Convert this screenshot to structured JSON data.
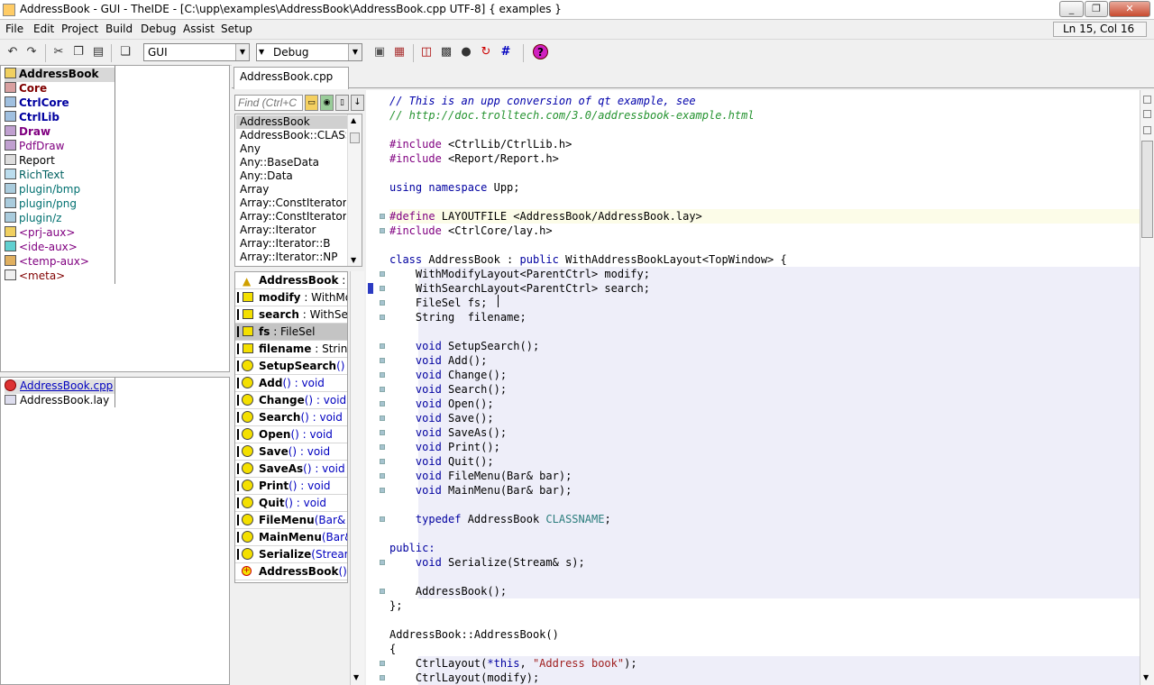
{
  "window": {
    "title": "AddressBook - GUI - TheIDE - [C:\\upp\\examples\\AddressBook\\AddressBook.cpp UTF-8] { examples }",
    "min_glyph": "_",
    "max_glyph": "❐",
    "close_glyph": "✕"
  },
  "menubar": {
    "items": [
      "File",
      "Edit",
      "Project",
      "Build",
      "Debug",
      "Assist",
      "Setup"
    ],
    "status": "Ln 15, Col 16"
  },
  "toolbar": {
    "icons": [
      "undo-icon",
      "redo-icon",
      "cut-icon",
      "copy-icon",
      "paste-icon",
      "paste-special-icon",
      "build-icon",
      "rebuild-icon",
      "stop-icon",
      "debug-icon",
      "run-icon",
      "restart-icon",
      "hash-icon",
      "help-icon"
    ],
    "main_config": "GUI",
    "build_mode": "Debug"
  },
  "packages": [
    {
      "name": "AddressBook",
      "bold": true,
      "color": "#000000",
      "selected": true
    },
    {
      "name": "Core",
      "bold": true,
      "color": "#800000"
    },
    {
      "name": "CtrlCore",
      "bold": true,
      "color": "#0000a0"
    },
    {
      "name": "CtrlLib",
      "bold": true,
      "color": "#0000a0"
    },
    {
      "name": "Draw",
      "bold": true,
      "color": "#800080"
    },
    {
      "name": "PdfDraw",
      "bold": false,
      "color": "#800080"
    },
    {
      "name": "Report",
      "bold": false,
      "color": "#000000"
    },
    {
      "name": "RichText",
      "bold": false,
      "color": "#006060"
    },
    {
      "name": "plugin/bmp",
      "bold": false,
      "color": "#007070"
    },
    {
      "name": "plugin/png",
      "bold": false,
      "color": "#007070"
    },
    {
      "name": "plugin/z",
      "bold": false,
      "color": "#007070"
    },
    {
      "name": "<prj-aux>",
      "bold": false,
      "color": "#800080"
    },
    {
      "name": "<ide-aux>",
      "bold": false,
      "color": "#800080"
    },
    {
      "name": "<temp-aux>",
      "bold": false,
      "color": "#800080"
    },
    {
      "name": "<meta>",
      "bold": false,
      "color": "#800000"
    }
  ],
  "files": [
    {
      "name": "AddressBook.cpp",
      "selected": true
    },
    {
      "name": "AddressBook.lay",
      "selected": false
    }
  ],
  "tab": {
    "label": "AddressBook.cpp"
  },
  "navigator": {
    "find_placeholder": "Find (Ctrl+C",
    "scopes": [
      "AddressBook",
      "AddressBook::CLASS",
      "Any",
      "Any::BaseData",
      "Any::Data",
      "Array",
      "Array::ConstIterator",
      "Array::ConstIterator:",
      "Array::Iterator",
      "Array::Iterator::B",
      "Array::Iterator::NP"
    ],
    "members": [
      {
        "name": "AddressBook",
        "type": " : pu",
        "icon": "triangle"
      },
      {
        "name": "modify",
        "type": " : WithMoc",
        "icon": "var"
      },
      {
        "name": "search",
        "type": " : WithSearc",
        "icon": "var"
      },
      {
        "name": "fs",
        "type": " : FileSel",
        "icon": "var",
        "selected": true
      },
      {
        "name": "filename",
        "type": " : String",
        "icon": "var"
      },
      {
        "name": "SetupSearch",
        "type": "() : vo",
        "icon": "func"
      },
      {
        "name": "Add",
        "type": "() : void",
        "icon": "func"
      },
      {
        "name": "Change",
        "type": "() : void",
        "icon": "func"
      },
      {
        "name": "Search",
        "type": "() : void",
        "icon": "func"
      },
      {
        "name": "Open",
        "type": "() : void",
        "icon": "func"
      },
      {
        "name": "Save",
        "type": "() : void",
        "icon": "func"
      },
      {
        "name": "SaveAs",
        "type": "() : void",
        "icon": "func"
      },
      {
        "name": "Print",
        "type": "() : void",
        "icon": "func"
      },
      {
        "name": "Quit",
        "type": "() : void",
        "icon": "func"
      },
      {
        "name": "FileMenu",
        "type": "(Bar& ba",
        "icon": "func"
      },
      {
        "name": "MainMenu",
        "type": "(Bar& b",
        "icon": "func"
      },
      {
        "name": "Serialize",
        "type": "(Stream&",
        "icon": "func"
      },
      {
        "name": "AddressBook",
        "type": "()",
        "icon": "ctor"
      }
    ]
  },
  "code_lines": [
    [
      [
        "cmt",
        "// This is an upp conversion of qt example, see"
      ]
    ],
    [
      [
        "cmtg",
        "// http://doc.trolltech.com/3.0/addressbook-example.html"
      ]
    ],
    [],
    [
      [
        "pp",
        "#include "
      ],
      [
        "",
        "<CtrlLib/CtrlLib.h>"
      ]
    ],
    [
      [
        "pp",
        "#include "
      ],
      [
        "",
        "<Report/Report.h>"
      ]
    ],
    [],
    [
      [
        "kw",
        "using namespace "
      ],
      [
        "",
        "Upp;"
      ]
    ],
    [],
    [
      [
        "pp",
        "#define "
      ],
      [
        "",
        "LAYOUTFILE <AddressBook/AddressBook.lay>"
      ]
    ],
    [
      [
        "pp",
        "#include "
      ],
      [
        "",
        "<CtrlCore/lay.h>"
      ]
    ],
    [],
    [
      [
        "kw",
        "class "
      ],
      [
        "",
        "AddressBook : "
      ],
      [
        "kw",
        "public "
      ],
      [
        "",
        "WithAddressBookLayout<TopWindow> {"
      ]
    ],
    [
      [
        "",
        "    WithModifyLayout<ParentCtrl> modify;"
      ]
    ],
    [
      [
        "",
        "    WithSearchLayout<ParentCtrl> search;"
      ]
    ],
    [
      [
        "",
        "    FileSel fs;"
      ]
    ],
    [
      [
        "",
        "    String  filename;"
      ]
    ],
    [],
    [
      [
        "kw",
        "    void "
      ],
      [
        "",
        "SetupSearch();"
      ]
    ],
    [
      [
        "kw",
        "    void "
      ],
      [
        "",
        "Add();"
      ]
    ],
    [
      [
        "kw",
        "    void "
      ],
      [
        "",
        "Change();"
      ]
    ],
    [
      [
        "kw",
        "    void "
      ],
      [
        "",
        "Search();"
      ]
    ],
    [
      [
        "kw",
        "    void "
      ],
      [
        "",
        "Open();"
      ]
    ],
    [
      [
        "kw",
        "    void "
      ],
      [
        "",
        "Save();"
      ]
    ],
    [
      [
        "kw",
        "    void "
      ],
      [
        "",
        "SaveAs();"
      ]
    ],
    [
      [
        "kw",
        "    void "
      ],
      [
        "",
        "Print();"
      ]
    ],
    [
      [
        "kw",
        "    void "
      ],
      [
        "",
        "Quit();"
      ]
    ],
    [
      [
        "kw",
        "    void "
      ],
      [
        "",
        "FileMenu(Bar& bar);"
      ]
    ],
    [
      [
        "kw",
        "    void "
      ],
      [
        "",
        "MainMenu(Bar& bar);"
      ]
    ],
    [],
    [
      [
        "kw",
        "    typedef "
      ],
      [
        "",
        "AddressBook "
      ],
      [
        "cls",
        "CLASSNAME"
      ],
      [
        "",
        ";"
      ]
    ],
    [],
    [
      [
        "kw",
        "public:"
      ]
    ],
    [
      [
        "kw",
        "    void "
      ],
      [
        "",
        "Serialize(Stream& s);"
      ]
    ],
    [],
    [
      [
        "",
        "    AddressBook();"
      ]
    ],
    [
      [
        "",
        "};"
      ]
    ],
    [],
    [
      [
        "",
        "AddressBook::AddressBook()"
      ]
    ],
    [
      [
        "",
        "{"
      ]
    ],
    [
      [
        "",
        "    CtrlLayout("
      ],
      [
        "kw",
        "*this"
      ],
      [
        "",
        ", "
      ],
      [
        "str",
        "\"Address book\""
      ],
      [
        "",
        ");"
      ]
    ],
    [
      [
        "",
        "    CtrlLayout(modify);"
      ]
    ]
  ]
}
